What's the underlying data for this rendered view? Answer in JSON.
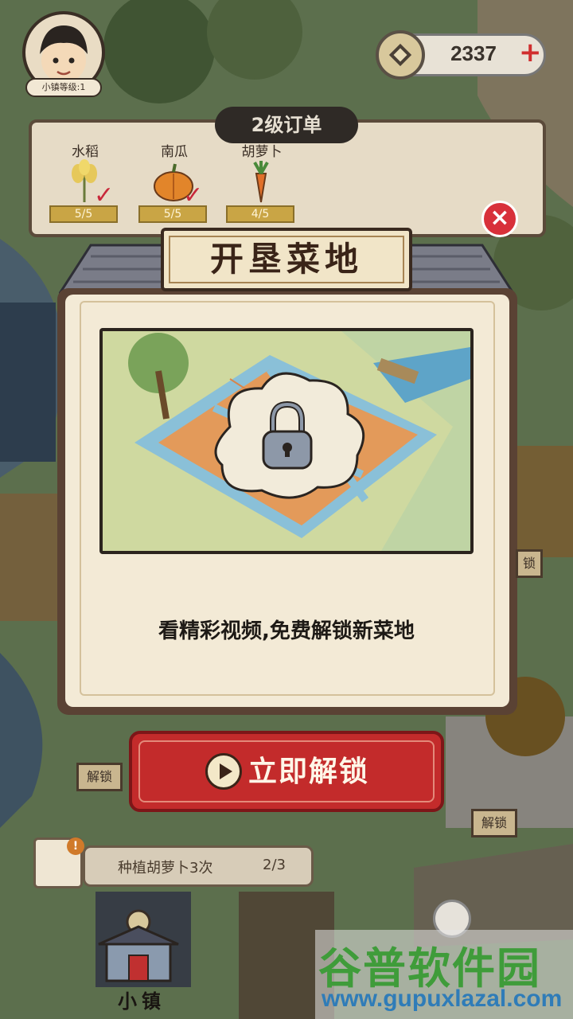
{
  "hud": {
    "avatar_label": "小镇等级:1",
    "coins": "2337",
    "plus_symbol": "+"
  },
  "order": {
    "title": "2级订单",
    "items": [
      {
        "name": "水稻",
        "progress": "5/5",
        "complete": true
      },
      {
        "name": "南瓜",
        "progress": "5/5",
        "complete": true
      },
      {
        "name": "胡萝卜",
        "progress": "4/5",
        "complete": false
      }
    ]
  },
  "dialog": {
    "title": "开垦菜地",
    "description": "看精彩视频,免费解锁新菜地",
    "button_label": "立即解锁",
    "close_symbol": "×"
  },
  "task": {
    "text": "种植胡萝卜3次",
    "count": "2/3",
    "alert": "!"
  },
  "bottom": {
    "town_label": "小镇",
    "sign_unlock_left": "解锁",
    "sign_unlock_right": "解锁",
    "sign_small": "锁"
  },
  "watermark": {
    "title": "谷普软件园",
    "url": "www.gupuxlazal.com"
  },
  "colors": {
    "accent_red": "#c32b2b",
    "dialog_bg": "#f3ead6",
    "coin_plus": "#d02e2e"
  }
}
